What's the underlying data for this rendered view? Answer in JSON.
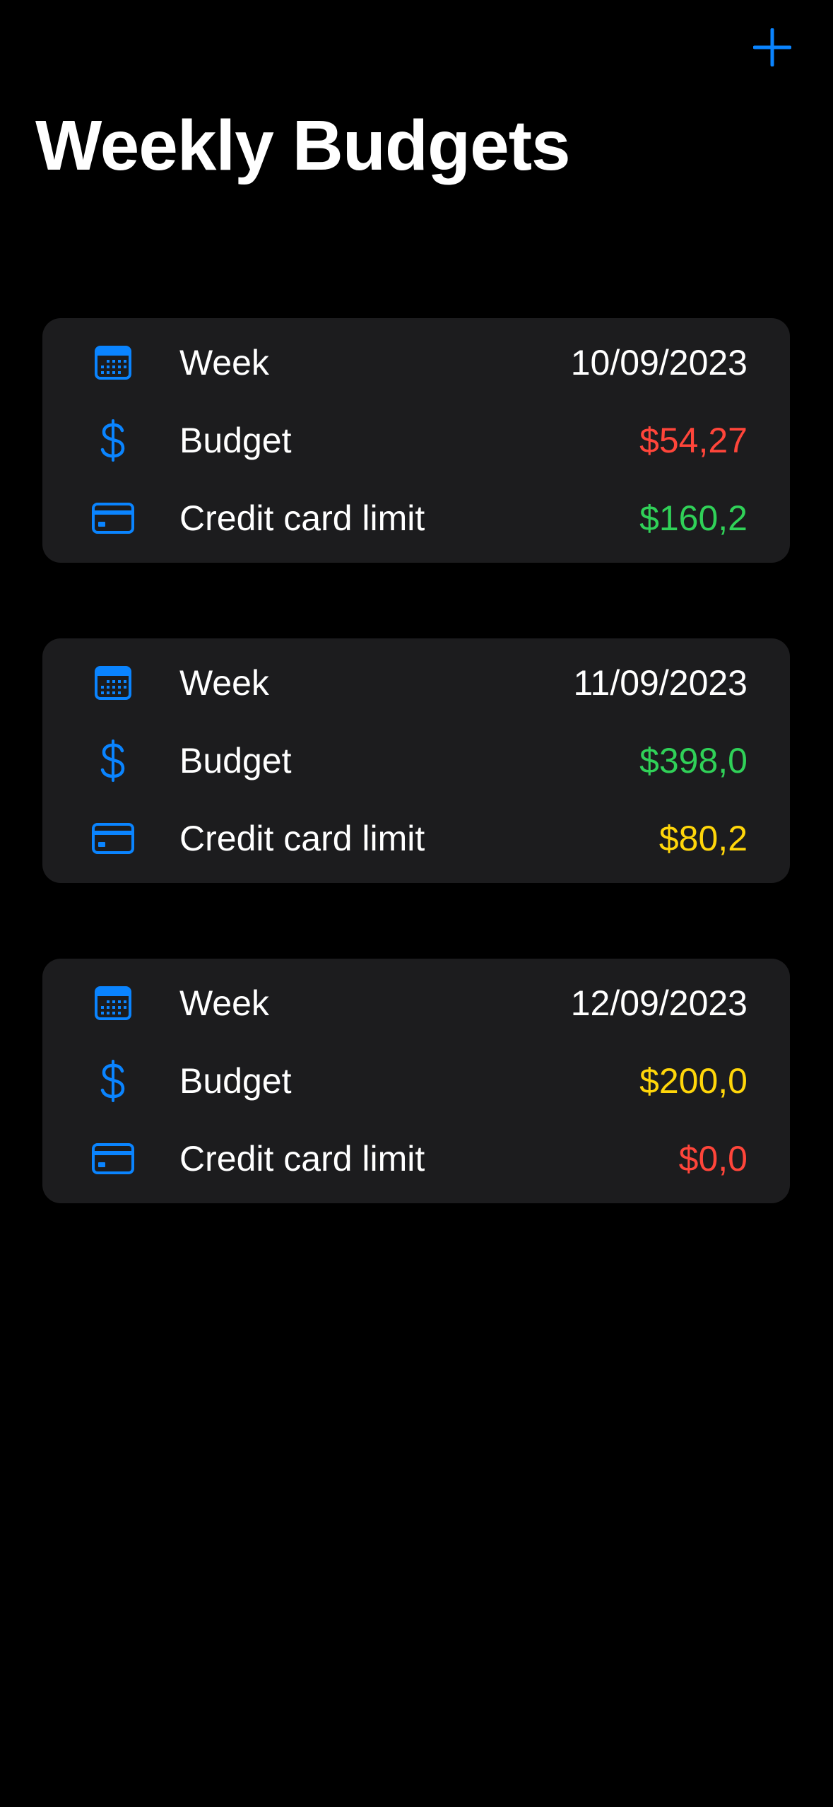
{
  "header": {
    "title": "Weekly Budgets",
    "add_icon": "plus-icon"
  },
  "colors": {
    "accent": "#0a84ff",
    "red": "#ff453a",
    "green": "#30d158",
    "yellow": "#ffd60a",
    "card_bg": "#1c1c1e",
    "background": "#000000"
  },
  "labels": {
    "week": "Week",
    "budget": "Budget",
    "credit_limit": "Credit card limit"
  },
  "icons": {
    "week": "calendar-icon",
    "budget": "dollar-sign-icon",
    "credit_limit": "credit-card-icon"
  },
  "budgets": [
    {
      "week": "10/09/2023",
      "budget": "$54,27",
      "budget_color": "#ff453a",
      "credit_limit": "$160,2",
      "credit_limit_color": "#30d158"
    },
    {
      "week": "11/09/2023",
      "budget": "$398,0",
      "budget_color": "#30d158",
      "credit_limit": "$80,2",
      "credit_limit_color": "#ffd60a"
    },
    {
      "week": "12/09/2023",
      "budget": "$200,0",
      "budget_color": "#ffd60a",
      "credit_limit": "$0,0",
      "credit_limit_color": "#ff453a"
    }
  ]
}
